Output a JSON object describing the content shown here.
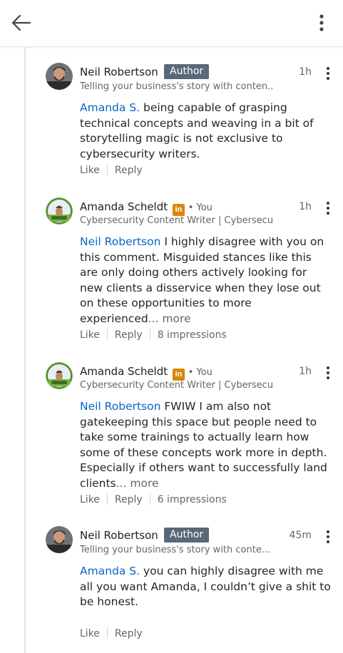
{
  "nav": {
    "back_icon": "arrow-left-icon",
    "menu_icon": "vertical-ellipsis-icon"
  },
  "colors": {
    "mention": "#0a66c2",
    "author_badge": "#5a6878",
    "linkedin_badge": "#d9860f"
  },
  "comments": [
    {
      "name": "Neil Robertson",
      "badge": "Author",
      "headline": "Telling your business's story with conten...",
      "time": "1h",
      "mention": "Amanda S.",
      "text": " being capable of grasping technical concepts and weaving in a bit of storytelling magic is not exclusive to cybersecurity writers.",
      "more": "",
      "like": "Like",
      "reply": "Reply",
      "impressions": ""
    },
    {
      "name": "Amanda Scheldt",
      "li_badge": "in",
      "you": "• You",
      "headline": "Cybersecurity Content Writer | Cybersecu...",
      "time": "1h",
      "mention": "Neil Robertson",
      "text": " I highly disagree with you on this comment. Misguided stances like this are only doing others actively looking for new clients a disservice when they lose out on these opportunities to more experienced",
      "more": "... more",
      "like": "Like",
      "reply": "Reply",
      "impressions": "8 impressions"
    },
    {
      "name": "Amanda Scheldt",
      "li_badge": "in",
      "you": "• You",
      "headline": "Cybersecurity Content Writer | Cybersecu...",
      "time": "1h",
      "mention": "Neil Robertson",
      "text": " FWIW I am also not gatekeeping this space but people need to take some trainings to actually learn how some of these concepts work more in depth. Especially if others want to successfully land clients",
      "more": "... more",
      "like": "Like",
      "reply": "Reply",
      "impressions": "6 impressions"
    },
    {
      "name": "Neil Robertson",
      "badge": "Author",
      "headline": "Telling your business's story with conte...",
      "time": "45m",
      "mention": "Amanda S.",
      "text": " you can highly disagree with me all you want Amanda, I couldn’t give a shit to be honest.",
      "more": "",
      "like": "Like",
      "reply": "Reply",
      "impressions": ""
    }
  ]
}
